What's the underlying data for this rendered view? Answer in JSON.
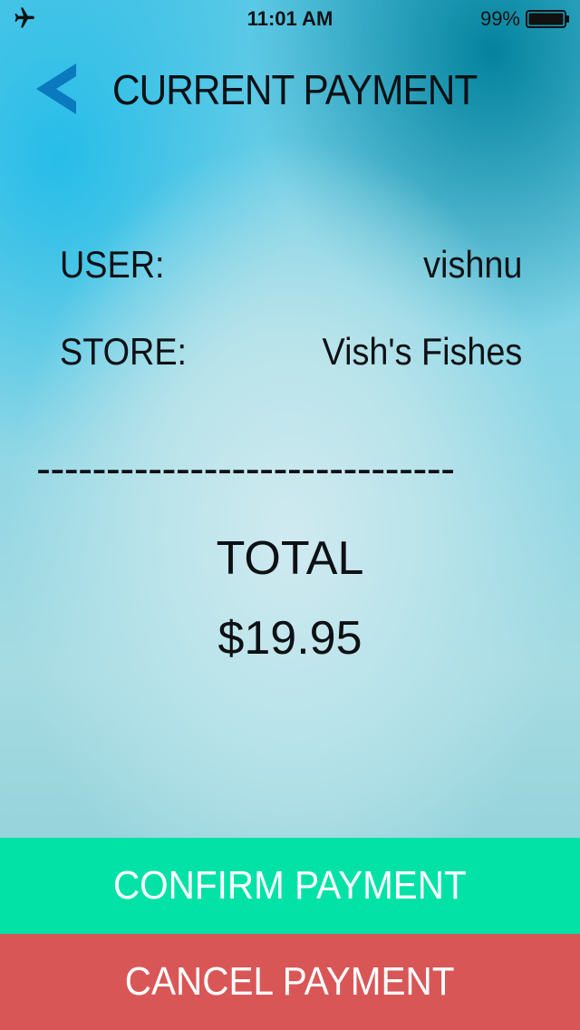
{
  "status_bar": {
    "time": "11:01 AM",
    "battery_percent": "99%",
    "icons": [
      "airplane-icon",
      "battery-icon"
    ]
  },
  "header": {
    "title": "CURRENT PAYMENT",
    "back_icon": "chevron-left-icon"
  },
  "details": {
    "user_label": "USER:",
    "user_value": "vishnu",
    "store_label": "STORE:",
    "store_value": "Vish's Fishes"
  },
  "divider": "------------------------------",
  "total": {
    "label": "TOTAL",
    "amount": "$19.95"
  },
  "actions": {
    "confirm_label": "CONFIRM PAYMENT",
    "cancel_label": "CANCEL PAYMENT"
  },
  "colors": {
    "accent_back": "#0b79be",
    "confirm": "#02e2a7",
    "cancel": "#d95657"
  }
}
